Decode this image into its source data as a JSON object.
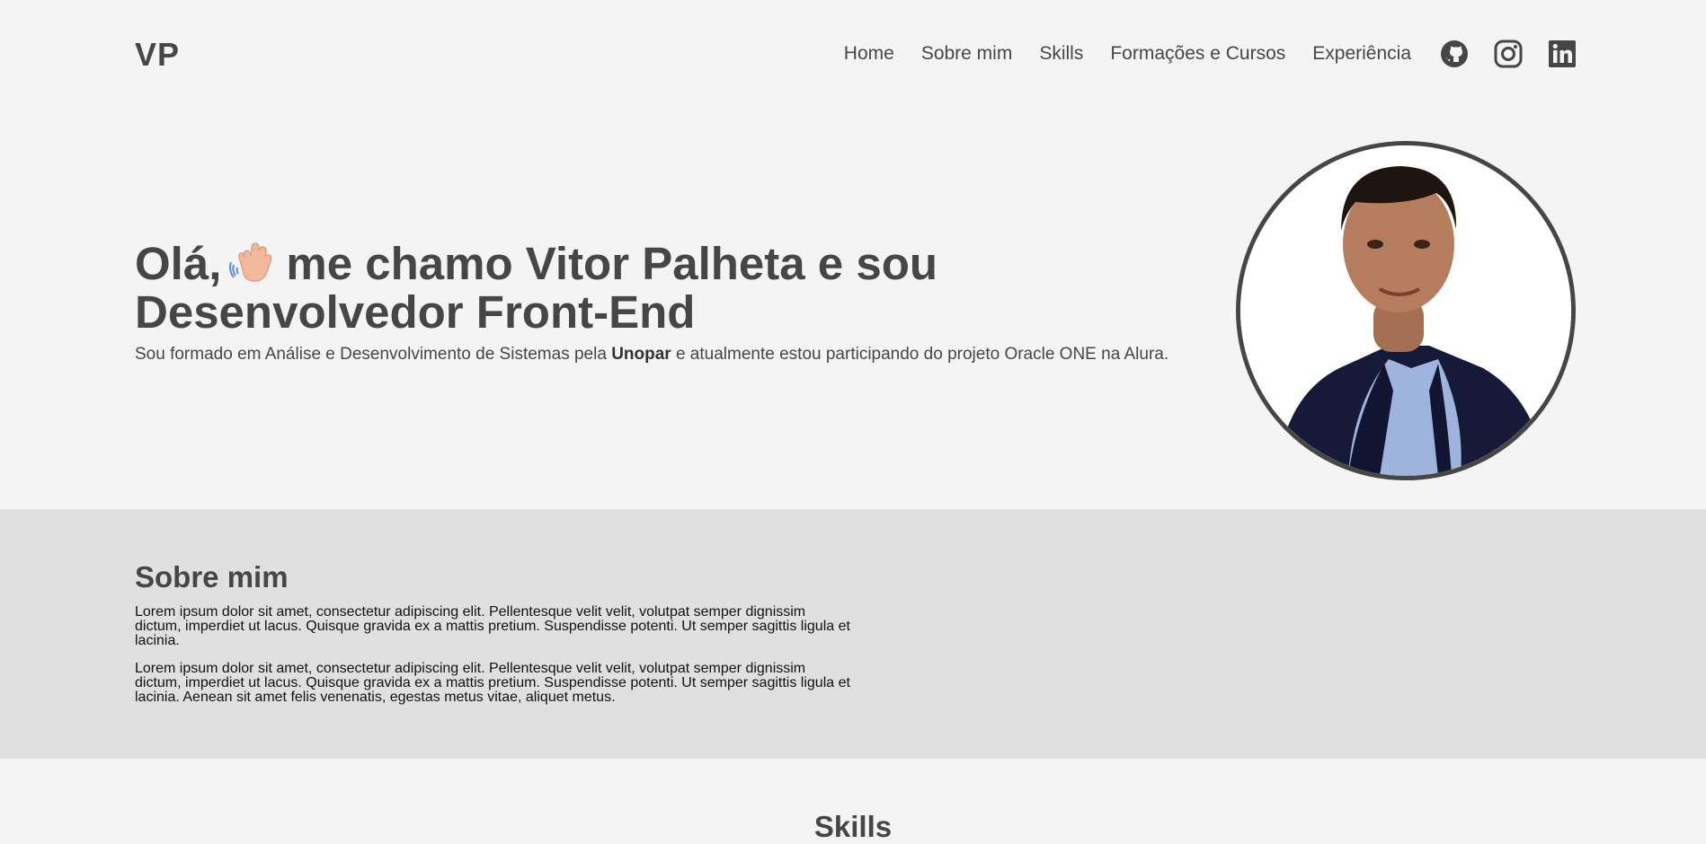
{
  "header": {
    "logo": "VP",
    "nav": {
      "home": "Home",
      "sobre": "Sobre mim",
      "skills": "Skills",
      "formacoes": "Formações e Cursos",
      "experiencia": "Experiência"
    },
    "social_icons": [
      "github-icon",
      "instagram-icon",
      "linkedin-icon"
    ]
  },
  "hero": {
    "title_before": "Olá,",
    "title_after": "me chamo Vitor Palheta e sou Desenvolvedor Front-End",
    "emoji": "waving-hand-icon",
    "subtitle_before": "Sou formado em Análise e Desenvolvimento de Sistemas pela ",
    "subtitle_bold": "Unopar",
    "subtitle_after": " e atualmente estou participando do projeto Oracle ONE na Alura."
  },
  "about": {
    "title": "Sobre mim",
    "paragraph1": "Lorem ipsum dolor sit amet, consectetur adipiscing elit. Pellentesque velit velit, volutpat semper dignissim dictum, imperdiet ut lacus. Quisque gravida ex a mattis pretium. Suspendisse potenti. Ut semper sagittis ligula et lacinia.",
    "paragraph2": "Lorem ipsum dolor sit amet, consectetur adipiscing elit. Pellentesque velit velit, volutpat semper dignissim dictum, imperdiet ut lacus. Quisque gravida ex a mattis pretium. Suspendisse potenti. Ut semper sagittis ligula et lacinia. Aenean sit amet felis venenatis, egestas metus vitae, aliquet metus."
  },
  "skills": {
    "title": "Skills"
  },
  "colors": {
    "text": "#464646",
    "background": "#f4f4f4",
    "section_alt": "#e0e0e0"
  }
}
